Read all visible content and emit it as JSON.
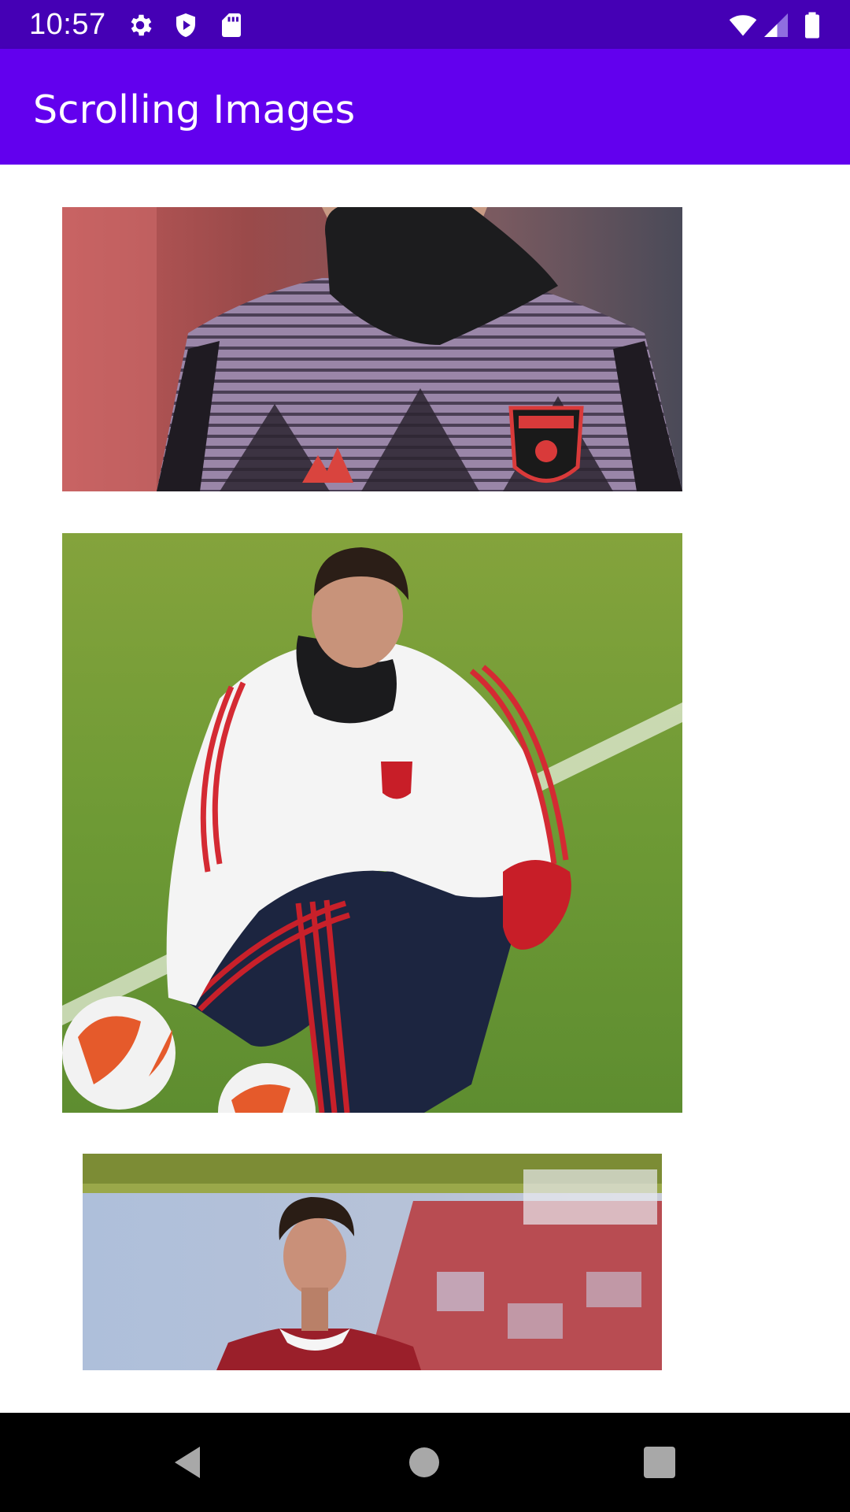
{
  "status_bar": {
    "time": "10:57",
    "background": "#4500b5",
    "icons_left": [
      "settings-icon",
      "shield-icon",
      "sd-card-icon"
    ],
    "icons_right": [
      "wifi-icon",
      "signal-icon",
      "battery-icon"
    ]
  },
  "app_bar": {
    "title": "Scrolling Images",
    "background": "#6200ee"
  },
  "images": [
    {
      "subject": "player-torso-purple-training-top"
    },
    {
      "subject": "player-crouching-on-pitch-with-ball"
    },
    {
      "subject": "player-portrait-stadium-background"
    }
  ],
  "nav_bar": {
    "buttons": [
      "back-icon",
      "home-icon",
      "recents-icon"
    ]
  }
}
